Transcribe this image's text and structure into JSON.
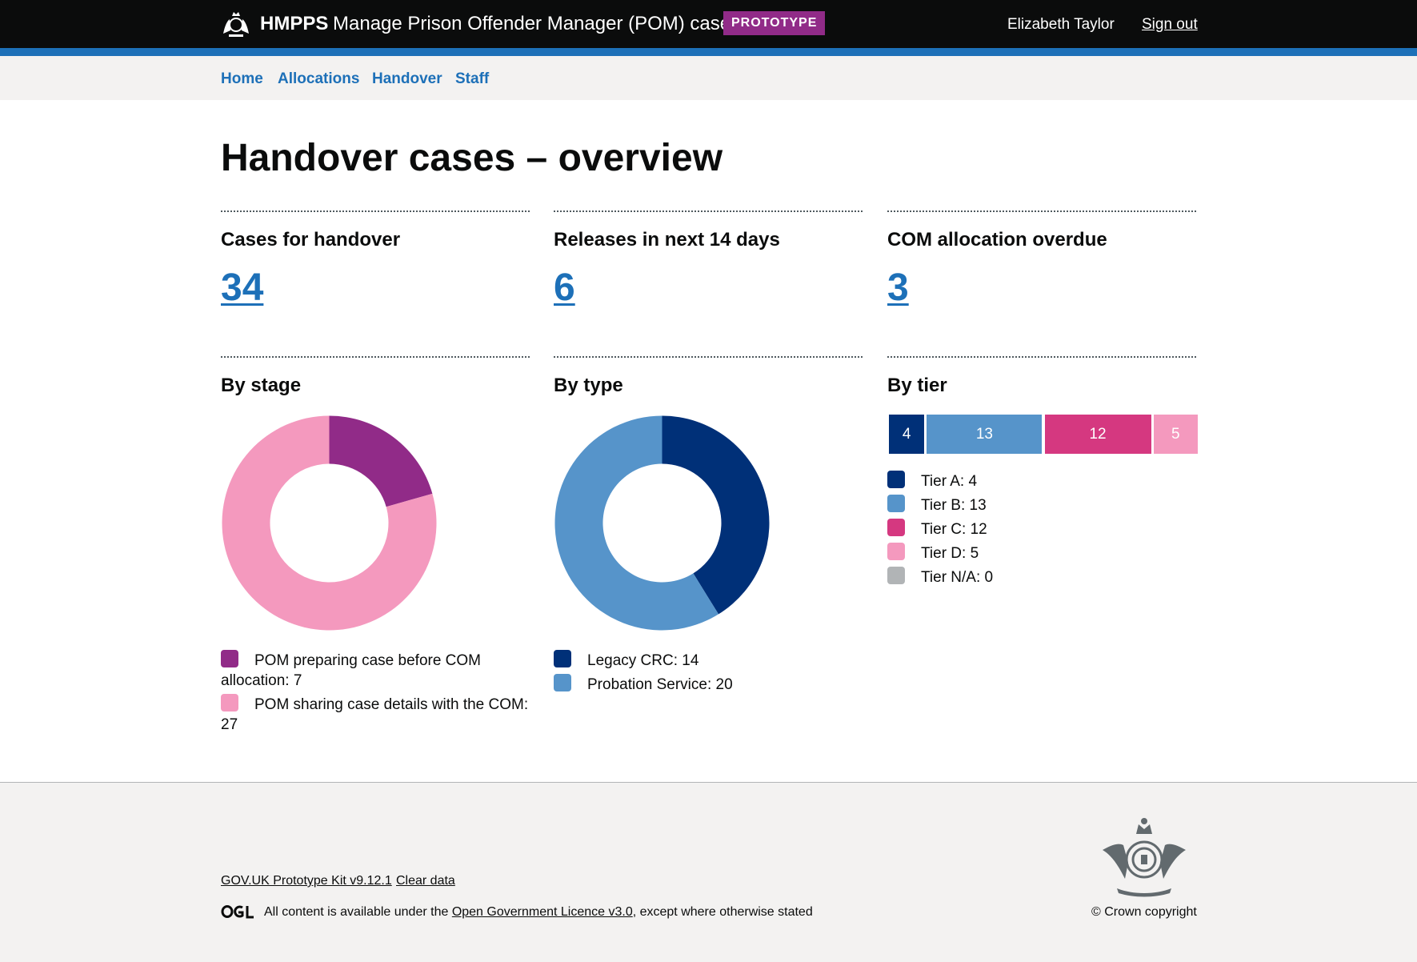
{
  "header": {
    "org": "HMPPS",
    "service_name": "Manage Prison Offender Manager (POM) cases",
    "phase_tag": "PROTOTYPE",
    "user_name": "Elizabeth Taylor",
    "sign_out": "Sign out"
  },
  "nav": {
    "items": [
      {
        "label": "Home"
      },
      {
        "label": "Allocations"
      },
      {
        "label": "Handover"
      },
      {
        "label": "Staff"
      }
    ]
  },
  "page": {
    "title": "Handover cases – overview"
  },
  "summary_cards": [
    {
      "title": "Cases for handover",
      "value": "34"
    },
    {
      "title": "Releases in next 14 days",
      "value": "6"
    },
    {
      "title": "COM allocation overdue",
      "value": "3"
    }
  ],
  "chart_data": [
    {
      "type": "pie",
      "title": "By stage",
      "donut": true,
      "slices": [
        {
          "label": "POM preparing case before COM allocation",
          "value": 7,
          "color": "#912b88",
          "legend": "POM preparing case before COM allocation: 7"
        },
        {
          "label": "POM sharing case details with the COM",
          "value": 27,
          "color": "#f499be",
          "legend": "POM sharing case details with the COM: 27"
        }
      ]
    },
    {
      "type": "pie",
      "title": "By type",
      "donut": true,
      "slices": [
        {
          "label": "Legacy CRC",
          "value": 14,
          "color": "#003078",
          "legend": "Legacy CRC: 14"
        },
        {
          "label": "Probation Service",
          "value": 20,
          "color": "#5694ca",
          "legend": "Probation Service: 20"
        }
      ]
    },
    {
      "type": "bar",
      "stacked": true,
      "orientation": "horizontal",
      "title": "By tier",
      "segments": [
        {
          "label": "Tier A",
          "value": 4,
          "display": "4",
          "color": "#003078",
          "legend": "Tier A: 4"
        },
        {
          "label": "Tier B",
          "value": 13,
          "display": "13",
          "color": "#5694ca",
          "legend": "Tier B: 13"
        },
        {
          "label": "Tier C",
          "value": 12,
          "display": "12",
          "color": "#d53880",
          "legend": "Tier C: 12"
        },
        {
          "label": "Tier D",
          "value": 5,
          "display": "5",
          "color": "#f499be",
          "legend": "Tier D: 5"
        },
        {
          "label": "Tier N/A",
          "value": 0,
          "display": "0",
          "color": "#b1b4b6",
          "legend": "Tier N/A: 0"
        }
      ]
    }
  ],
  "footer": {
    "kit_link": "GOV.UK Prototype Kit v9.12.1",
    "clear_data": "Clear data",
    "licence_prefix": "All content is available under the ",
    "licence_link": "Open Government Licence v3.0",
    "licence_suffix": ", except where otherwise stated",
    "copyright": "© Crown copyright"
  }
}
